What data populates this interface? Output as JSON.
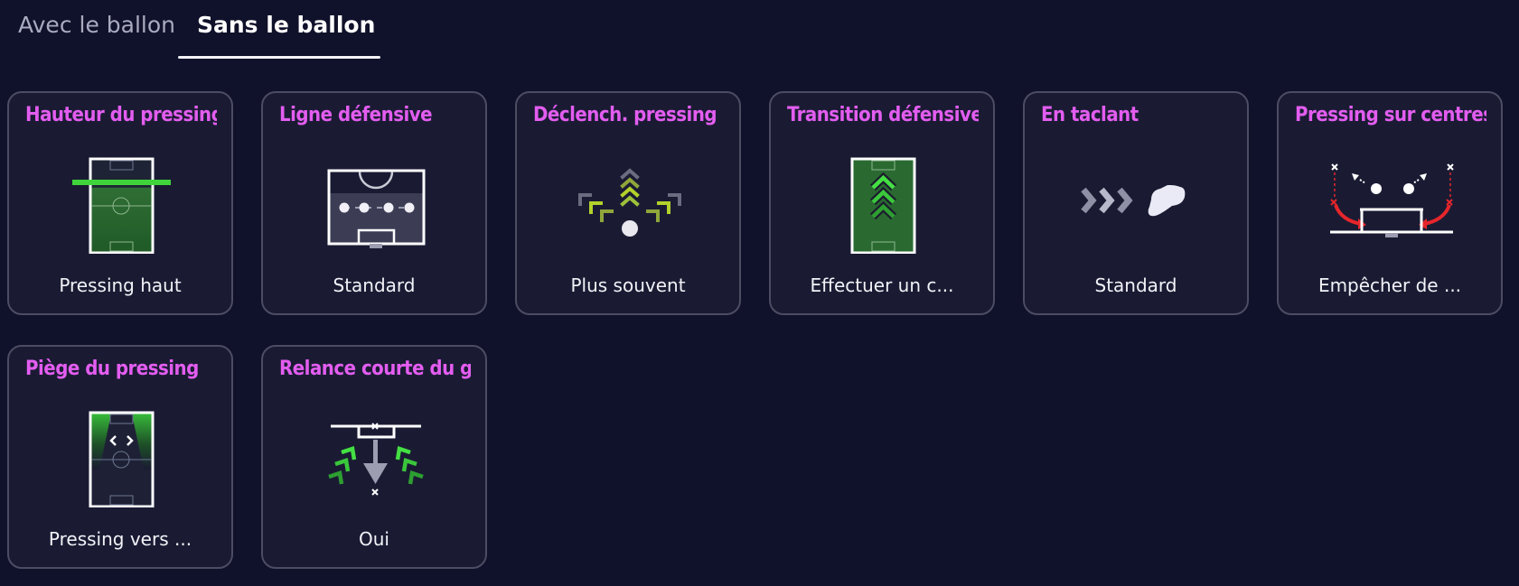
{
  "tabs": {
    "with_ball": "Avec le ballon",
    "without_ball": "Sans le ballon",
    "active": "without_ball"
  },
  "colors": {
    "background": "#10112a",
    "card_background": "#1a1b33",
    "card_border": "#4c4d63",
    "title_accent": "#e35df0",
    "green_accent": "#3fd43a",
    "red_accent": "#e5262b"
  },
  "cards": [
    {
      "title": "Hauteur du pressing",
      "value": "Pressing haut",
      "icon": "pitch-high-press-line-icon"
    },
    {
      "title": "Ligne défensive",
      "value": "Standard",
      "icon": "defensive-line-icon"
    },
    {
      "title": "Déclench. pressing",
      "value": "Plus souvent",
      "icon": "pressing-trigger-arrows-icon"
    },
    {
      "title": "Transition défensive",
      "value": "Effectuer un c...",
      "icon": "pitch-chevrons-up-icon"
    },
    {
      "title": "En taclant",
      "value": "Standard",
      "icon": "boot-tackle-icon"
    },
    {
      "title": "Pressing sur centres",
      "value": "Empêcher de ...",
      "icon": "cross-pressing-icon"
    },
    {
      "title": "Piège du pressing",
      "value": "Pressing vers ...",
      "icon": "pitch-press-trap-icon"
    },
    {
      "title": "Relance courte du gardien",
      "value": "Oui",
      "icon": "goalkeeper-short-distribution-icon"
    }
  ]
}
